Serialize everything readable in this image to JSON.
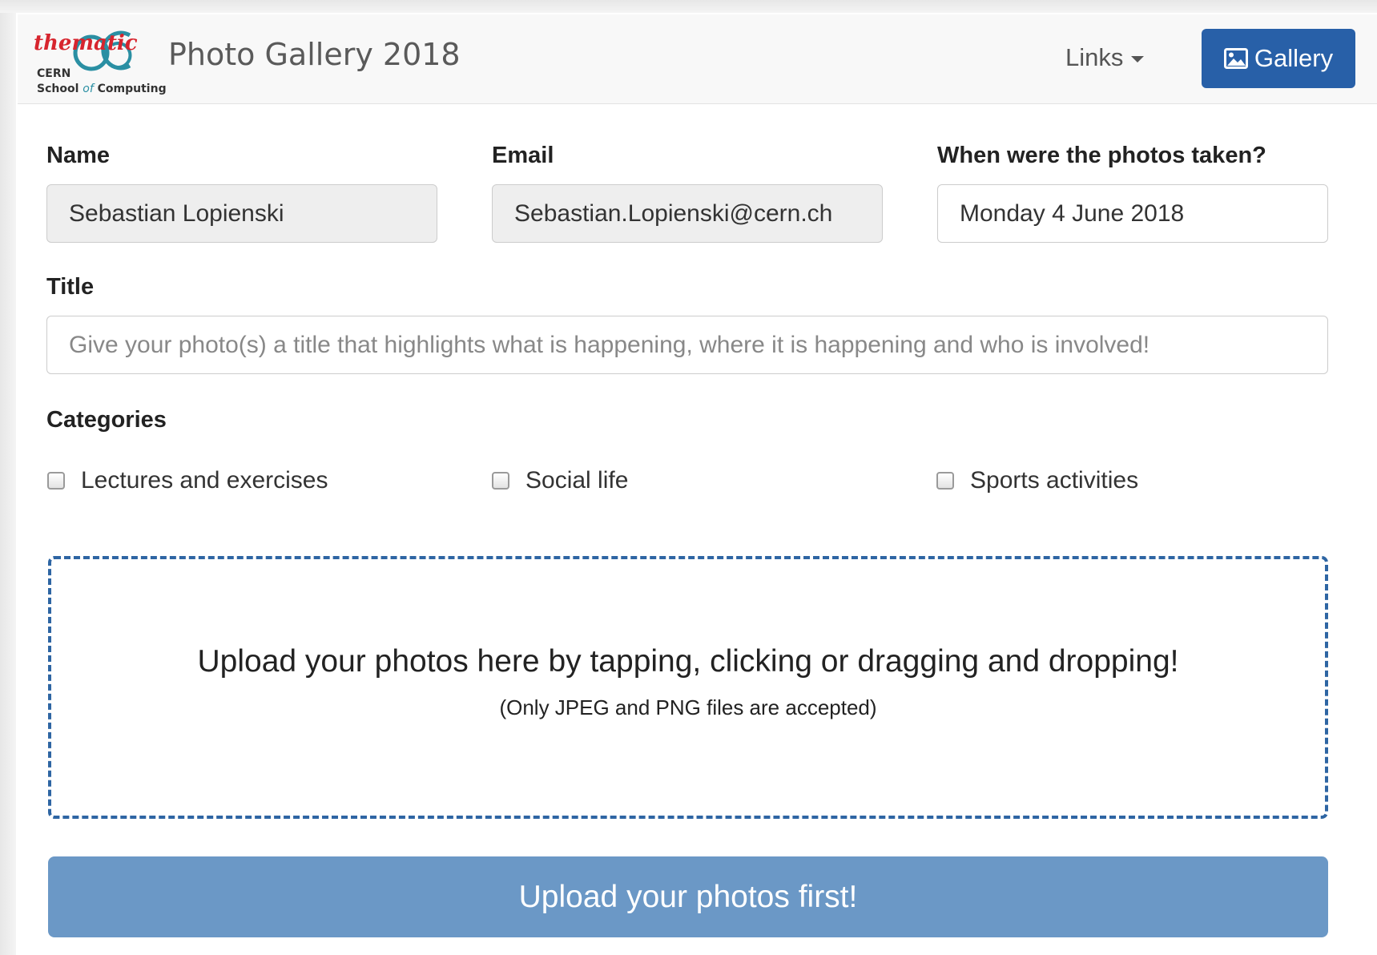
{
  "navbar": {
    "logo": {
      "script_text": "thematic",
      "letters": "CSC",
      "org": "CERN",
      "school_a": "School",
      "school_of": "of",
      "school_b": "Computing"
    },
    "title": "Photo Gallery 2018",
    "links_label": "Links",
    "gallery_label": "Gallery"
  },
  "form": {
    "name": {
      "label": "Name",
      "value": "Sebastian Lopienski"
    },
    "email": {
      "label": "Email",
      "value": "Sebastian.Lopienski@cern.ch"
    },
    "date": {
      "label": "When were the photos taken?",
      "value": "Monday 4 June 2018"
    },
    "title": {
      "label": "Title",
      "placeholder": "Give your photo(s) a title that highlights what is happening, where it is happening and who is involved!"
    },
    "categories": {
      "label": "Categories",
      "items": [
        {
          "label": "Lectures and exercises",
          "checked": false
        },
        {
          "label": "Social life",
          "checked": false
        },
        {
          "label": "Sports activities",
          "checked": false
        }
      ]
    }
  },
  "dropzone": {
    "main_text": "Upload your photos here by tapping, clicking or dragging and dropping!",
    "sub_text": "(Only JPEG and PNG files are accepted)"
  },
  "upload_button": {
    "label": "Upload your photos first!"
  },
  "colors": {
    "primary": "#2860a8",
    "disabled_button": "#6b98c6",
    "dropzone_border": "#2e65a3",
    "logo_red": "#d7252e",
    "logo_teal": "#2a8fa3"
  }
}
